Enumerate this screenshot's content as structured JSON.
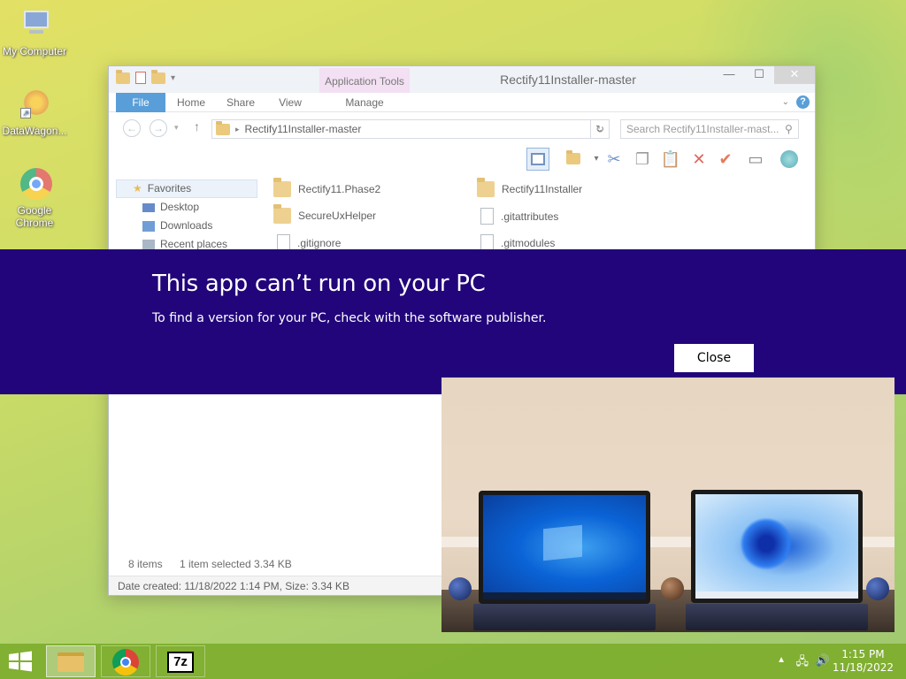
{
  "desktop": {
    "icons": [
      {
        "label": "My Computer"
      },
      {
        "label": "DataWagon..."
      },
      {
        "label": "Google Chrome"
      }
    ]
  },
  "explorer": {
    "title": "Rectify11Installer-master",
    "contextual_tab": "Application Tools",
    "tabs": {
      "file": "File",
      "home": "Home",
      "share": "Share",
      "view": "View",
      "manage": "Manage"
    },
    "address_path": "Rectify11Installer-master",
    "search_placeholder": "Search Rectify11Installer-mast...",
    "nav": {
      "favorites": "Favorites",
      "desktop": "Desktop",
      "downloads": "Downloads",
      "recent": "Recent places"
    },
    "files": [
      {
        "name": "Rectify11.Phase2",
        "type": "folder"
      },
      {
        "name": "Rectify11Installer",
        "type": "folder"
      },
      {
        "name": "SecureUxHelper",
        "type": "folder"
      },
      {
        "name": ".gitattributes",
        "type": "file"
      },
      {
        "name": ".gitignore",
        "type": "file"
      },
      {
        "name": ".gitmodules",
        "type": "file"
      }
    ],
    "status": {
      "items": "8 items",
      "selected": "1 item selected  3.34 KB"
    },
    "details": "Date created: 11/18/2022 1:14 PM, Size: 3.34 KB"
  },
  "dialog": {
    "title": "This app can’t run on your PC",
    "message": "To find a version for your PC, check with the software publisher.",
    "close_label": "Close",
    "background": "#22057a"
  },
  "taskbar": {
    "time": "1:15 PM",
    "date": "11/18/2022",
    "apps": [
      "file-explorer",
      "google-chrome",
      "7-zip"
    ],
    "seven_zip_label": "7z"
  }
}
